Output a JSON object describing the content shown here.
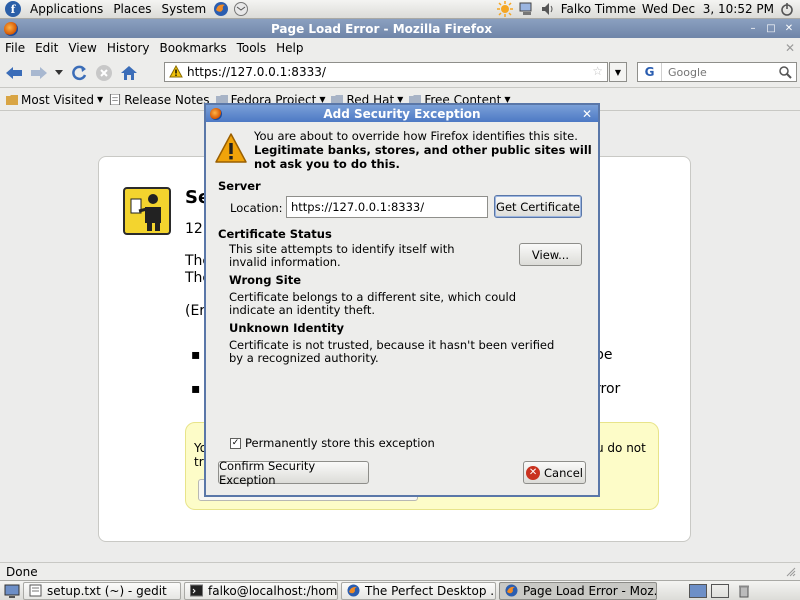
{
  "top_panel": {
    "menus": [
      "Applications",
      "Places",
      "System"
    ],
    "user": "Falko Timme",
    "clock": "Wed Dec  3, 10:52 PM"
  },
  "window": {
    "title": "Page Load Error - Mozilla Firefox"
  },
  "menubar": {
    "items": [
      {
        "label": "File"
      },
      {
        "label": "Edit"
      },
      {
        "label": "View"
      },
      {
        "label": "History"
      },
      {
        "label": "Bookmarks"
      },
      {
        "label": "Tools"
      },
      {
        "label": "Help"
      }
    ]
  },
  "navbar": {
    "url": "https://127.0.0.1:8333/",
    "search_placeholder": "Google"
  },
  "bookmarks": {
    "items": [
      {
        "label": "Most Visited"
      },
      {
        "label": "Release Notes"
      },
      {
        "label": "Fedora Project"
      },
      {
        "label": "Red Hat"
      },
      {
        "label": "Free Content"
      }
    ]
  },
  "error_page": {
    "title_fragment": "Se",
    "line1": "127",
    "line2": "The",
    "line3": "The",
    "line4": "(Er",
    "bullet1_tail": "be",
    "bullet2_tail": "rror",
    "yellow_line1_left": "Yo",
    "yellow_line1_right": "u do not",
    "yellow_line2_left": "tru"
  },
  "dialog": {
    "title": "Add Security Exception",
    "intro": "You are about to override how Firefox identifies this site.",
    "intro_bold": "Legitimate banks, stores, and other public sites will not ask you to do this.",
    "server_label": "Server",
    "location_label": "Location:",
    "location_value": "https://127.0.0.1:8333/",
    "get_certificate": "Get Certificate",
    "cert_status_label": "Certificate Status",
    "cert_status_text": "This site attempts to identify itself with invalid information.",
    "view_button": "View...",
    "wrong_site_label": "Wrong Site",
    "wrong_site_text": "Certificate belongs to a different site, which could indicate an identity theft.",
    "unknown_identity_label": "Unknown Identity",
    "unknown_identity_text": "Certificate is not trusted, because it hasn't been verified by a recognized authority.",
    "permanent_label": "Permanently store this exception",
    "permanent_checked": true,
    "confirm_button": "Confirm Security Exception",
    "cancel_button": "Cancel"
  },
  "statusbar": {
    "text": "Done"
  },
  "taskbar": {
    "tasks": [
      {
        "label": "setup.txt (~) - gedit"
      },
      {
        "label": "falko@localhost:/hom..."
      },
      {
        "label": "The Perfect Desktop ..."
      },
      {
        "label": "Page Load Error - Moz..."
      }
    ]
  },
  "colors": {
    "dialog_title": "#4d79c4",
    "warning": "#f0a30a",
    "cancel": "#c9321f",
    "notice_bg": "#fdfcc8"
  }
}
